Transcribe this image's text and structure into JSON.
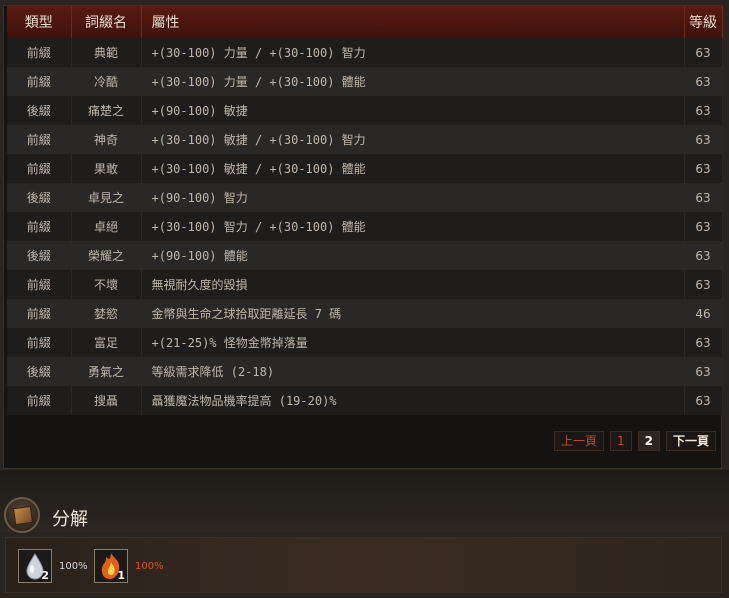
{
  "table": {
    "headers": {
      "type": "類型",
      "name": "詞綴名",
      "attr": "屬性",
      "level": "等級"
    },
    "rows": [
      {
        "type": "前綴",
        "name": "典範",
        "attr": "+(30-100) 力量 / +(30-100) 智力",
        "level": "63"
      },
      {
        "type": "前綴",
        "name": "冷酷",
        "attr": "+(30-100) 力量 / +(30-100) 體能",
        "level": "63"
      },
      {
        "type": "後綴",
        "name": "痛楚之",
        "attr": "+(90-100) 敏捷",
        "level": "63"
      },
      {
        "type": "前綴",
        "name": "神奇",
        "attr": "+(30-100) 敏捷 / +(30-100) 智力",
        "level": "63"
      },
      {
        "type": "前綴",
        "name": "果敢",
        "attr": "+(30-100) 敏捷 / +(30-100) 體能",
        "level": "63"
      },
      {
        "type": "後綴",
        "name": "卓見之",
        "attr": "+(90-100) 智力",
        "level": "63"
      },
      {
        "type": "前綴",
        "name": "卓絕",
        "attr": "+(30-100) 智力 / +(30-100) 體能",
        "level": "63"
      },
      {
        "type": "後綴",
        "name": "榮耀之",
        "attr": "+(90-100) 體能",
        "level": "63"
      },
      {
        "type": "前綴",
        "name": "不壞",
        "attr": "無視耐久度的毀損",
        "level": "63"
      },
      {
        "type": "前綴",
        "name": "婪慾",
        "attr": "金幣與生命之球拾取距離延長 7 碼",
        "level": "46"
      },
      {
        "type": "前綴",
        "name": "富足",
        "attr": "+(21-25)% 怪物金幣掉落量",
        "level": "63"
      },
      {
        "type": "後綴",
        "name": "勇氣之",
        "attr": "等級需求降低 (2-18)",
        "level": "63"
      },
      {
        "type": "前綴",
        "name": "搜聶",
        "attr": "聶獲魔法物品機率提高 (19-20)%",
        "level": "63"
      }
    ]
  },
  "pager": {
    "prev": "上一頁",
    "page1": "1",
    "page2": "2",
    "next": "下一頁"
  },
  "salvage": {
    "title": "分解",
    "items": [
      {
        "icon": "white-essence-icon",
        "count": "2",
        "percent": "100%",
        "color": "#d8d8e0"
      },
      {
        "icon": "fiery-brimstone-icon",
        "count": "1",
        "percent": "100%",
        "color": "#d4552a"
      }
    ]
  }
}
